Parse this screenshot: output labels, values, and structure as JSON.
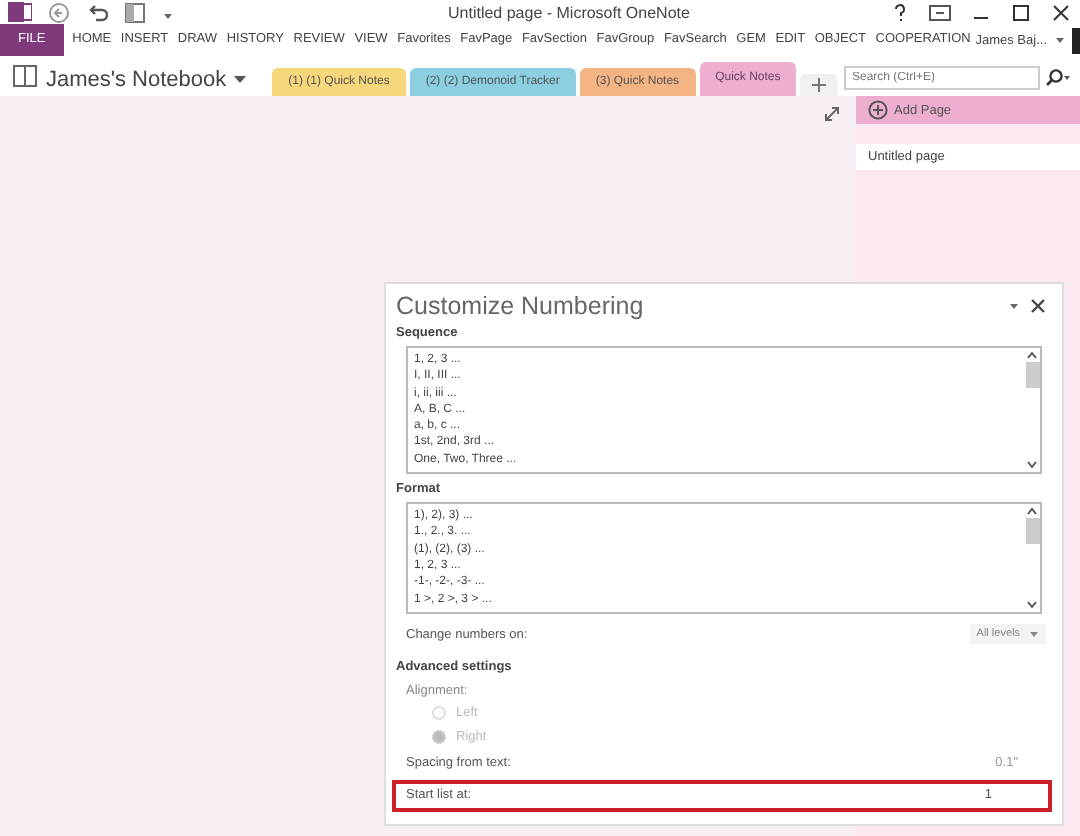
{
  "window": {
    "title": "Untitled page - Microsoft OneNote"
  },
  "ribbon_tabs": [
    {
      "label": "FILE",
      "selected": true
    },
    {
      "label": "HOME",
      "selected": false
    },
    {
      "label": "INSERT",
      "selected": false
    },
    {
      "label": "DRAW",
      "selected": false
    },
    {
      "label": "HISTORY",
      "selected": false
    },
    {
      "label": "REVIEW",
      "selected": false
    },
    {
      "label": "VIEW",
      "selected": false
    },
    {
      "label": "Favorites",
      "selected": false
    },
    {
      "label": "FavPage",
      "selected": false
    },
    {
      "label": "FavSection",
      "selected": false
    },
    {
      "label": "FavGroup",
      "selected": false
    },
    {
      "label": "FavSearch",
      "selected": false
    },
    {
      "label": "GEM",
      "selected": false
    },
    {
      "label": "EDIT",
      "selected": false
    },
    {
      "label": "OBJECT",
      "selected": false
    },
    {
      "label": "COOPERATION",
      "selected": false
    }
  ],
  "user": {
    "name": "James Baj..."
  },
  "notebook": {
    "name": "James's Notebook"
  },
  "sections": [
    {
      "label": "(1) (1) Quick Notes",
      "color": "#f6d77c",
      "selected": false
    },
    {
      "label": "(2) (2) Demonoid Tracker",
      "color": "#8ccfe0",
      "selected": false
    },
    {
      "label": "(3) Quick Notes",
      "color": "#f4b483",
      "selected": false
    },
    {
      "label": "Quick Notes",
      "color": "#eeaed0",
      "selected": true
    }
  ],
  "search": {
    "placeholder": "Search (Ctrl+E)"
  },
  "pages_panel": {
    "add_page": "Add Page",
    "pages": [
      {
        "title": "Untitled page",
        "selected": true
      }
    ]
  },
  "dialog": {
    "title": "Customize Numbering",
    "sequence": {
      "label": "Sequence",
      "items": [
        "1, 2, 3 ...",
        "I, II, III ...",
        "i, ii, iii ...",
        "A, B, C ...",
        "a, b, c ...",
        "1st, 2nd, 3rd ...",
        "One, Two, Three ..."
      ]
    },
    "format": {
      "label": "Format",
      "items": [
        "1), 2), 3) ...",
        "1., 2., 3. ...",
        "(1), (2), (3) ...",
        "1, 2, 3 ...",
        "-1-, -2-, -3- ...",
        "1 >, 2 >, 3 > ..."
      ]
    },
    "change_numbers_on": {
      "label": "Change numbers on:",
      "value": "All levels"
    },
    "advanced_label": "Advanced settings",
    "alignment": {
      "label": "Alignment:",
      "options": [
        {
          "label": "Left",
          "selected": false
        },
        {
          "label": "Right",
          "selected": true
        }
      ]
    },
    "spacing": {
      "label": "Spacing from text:",
      "value": "0.1\""
    },
    "start_list": {
      "label": "Start list at:",
      "value": "1",
      "highlighted": true
    }
  }
}
